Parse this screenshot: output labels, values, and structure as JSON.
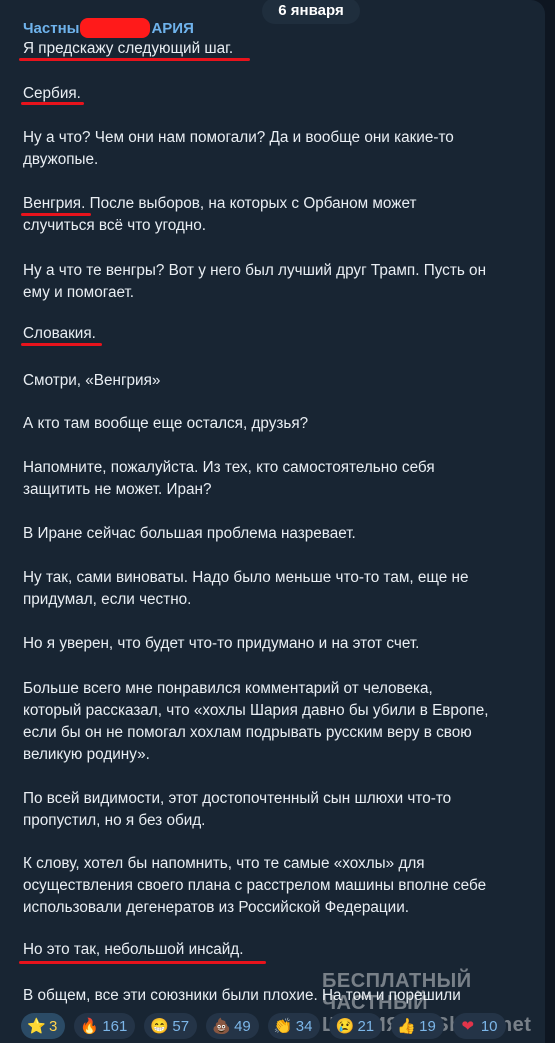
{
  "header": {
    "date": "6 января",
    "sender_start": "Частны",
    "sender_end": "АРИЯ"
  },
  "message": {
    "lines": [
      "Я предскажу следующий шаг.",
      "Сербия.",
      "Ну а что? Чем они нам помогали? Да и вообще они какие-то",
      "двужопые.",
      "Венгрия. После выборов, на которых с Орбаном может",
      "случиться всё что угодно.",
      "Ну а что те венгры? Вот у него был лучший друг Трамп. Пусть он",
      "ему и помогает.",
      "Словакия.",
      "Смотри, «Венгрия»",
      "А кто там вообще еще остался, друзья?",
      "Напомните, пожалуйста. Из тех, кто самостоятельно себя",
      "защитить не может. Иран?",
      "В Иране сейчас большая проблема назревает.",
      "Ну так, сами виноваты. Надо было меньше что-то там,  еще не",
      "придумал, если честно.",
      "Но я уверен, что будет что-то придумано и на этот счет.",
      "Больше всего мне понравился комментарий от человека,",
      "который рассказал, что «хохлы Шария давно бы убили в Европе,",
      "если бы он не помогал хохлам подрывать русским веру в свою",
      "великую родину».",
      "По всей видимости, этот достопочтенный сын шлюхи что-то",
      "пропустил, но я без обид.",
      " К слову, хотел бы напомнить, что те самые «хохлы» для",
      "осуществления своего плана с расстрелом машины вполне себе",
      "использовали дегенератов из Российской Федерации.",
      "Но это так, небольшой инсайд.",
      "В общем, все эти союзники были плохие. На том и порешили"
    ]
  },
  "watermark": {
    "line1": "БЕСПЛАТНЫЙ ЧАСТНЫЙ",
    "line2_a": "ШАРИЯ",
    "line2_b": "Sharii.net"
  },
  "reactions": [
    {
      "icon": "star-icon",
      "emoji": "⭐",
      "count": "3"
    },
    {
      "icon": "fire-icon",
      "emoji": "🔥",
      "count": "161"
    },
    {
      "icon": "grin-icon",
      "emoji": "😁",
      "count": "57"
    },
    {
      "icon": "poop-icon",
      "emoji": "💩",
      "count": "49"
    },
    {
      "icon": "clap-icon",
      "emoji": "👏",
      "count": "34"
    },
    {
      "icon": "cry-icon",
      "emoji": "😢",
      "count": "21"
    },
    {
      "icon": "thumbs-up-icon",
      "emoji": "👍",
      "count": "19"
    },
    {
      "icon": "heart-icon",
      "emoji": "❤",
      "count": "10"
    }
  ],
  "colors": {
    "background": "#0e1621",
    "bubble": "#182533",
    "underline": "#e8131c",
    "sender": "#6fb3ec",
    "paid_reaction": "#ffd24d"
  }
}
